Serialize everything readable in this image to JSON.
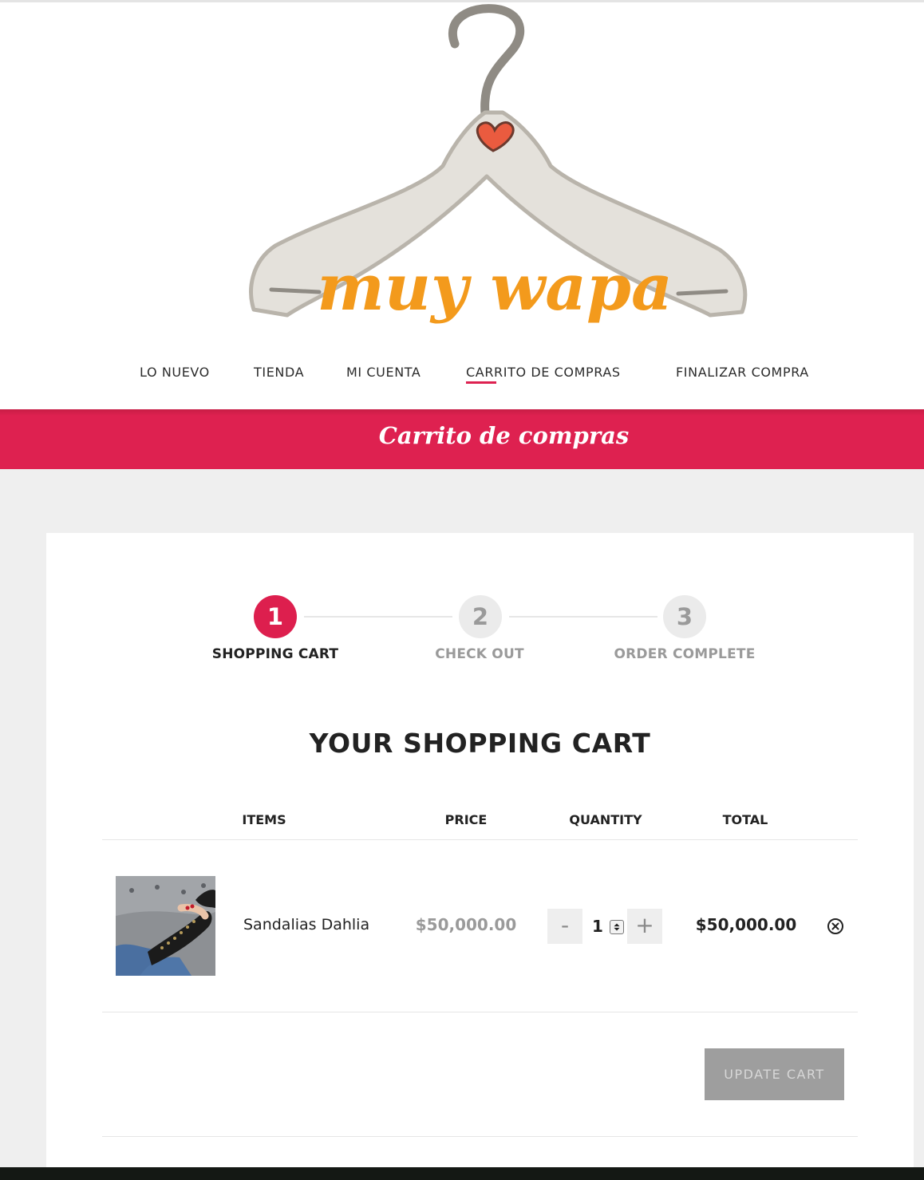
{
  "brand": {
    "logo_text": "muy wapa"
  },
  "nav": {
    "items": [
      "LO NUEVO",
      "TIENDA",
      "MI CUENTA",
      "CARRITO DE COMPRAS",
      "FINALIZAR COMPRA"
    ],
    "active_index": 3
  },
  "banner": {
    "title": "Carrito de compras"
  },
  "steps": [
    {
      "number": "1",
      "label": "SHOPPING CART",
      "active": true
    },
    {
      "number": "2",
      "label": "CHECK OUT",
      "active": false
    },
    {
      "number": "3",
      "label": "ORDER COMPLETE",
      "active": false
    }
  ],
  "cart": {
    "title": "YOUR SHOPPING CART",
    "columns": {
      "items": "ITEMS",
      "price": "PRICE",
      "quantity": "QUANTITY",
      "total": "TOTAL"
    },
    "rows": [
      {
        "name": "Sandalias Dahlia",
        "price": "$50,000.00",
        "quantity": "1",
        "total": "$50,000.00"
      }
    ],
    "minus_label": "-",
    "plus_label": "+",
    "update_label": "UPDATE CART"
  },
  "colors": {
    "accent": "#dd1f4e",
    "logo_orange": "#f39a1c",
    "hanger_gray": "#c9c5bd"
  },
  "icons": [
    "hanger-logo",
    "heart-icon",
    "remove-circle-icon",
    "spinner-arrows-icon"
  ]
}
